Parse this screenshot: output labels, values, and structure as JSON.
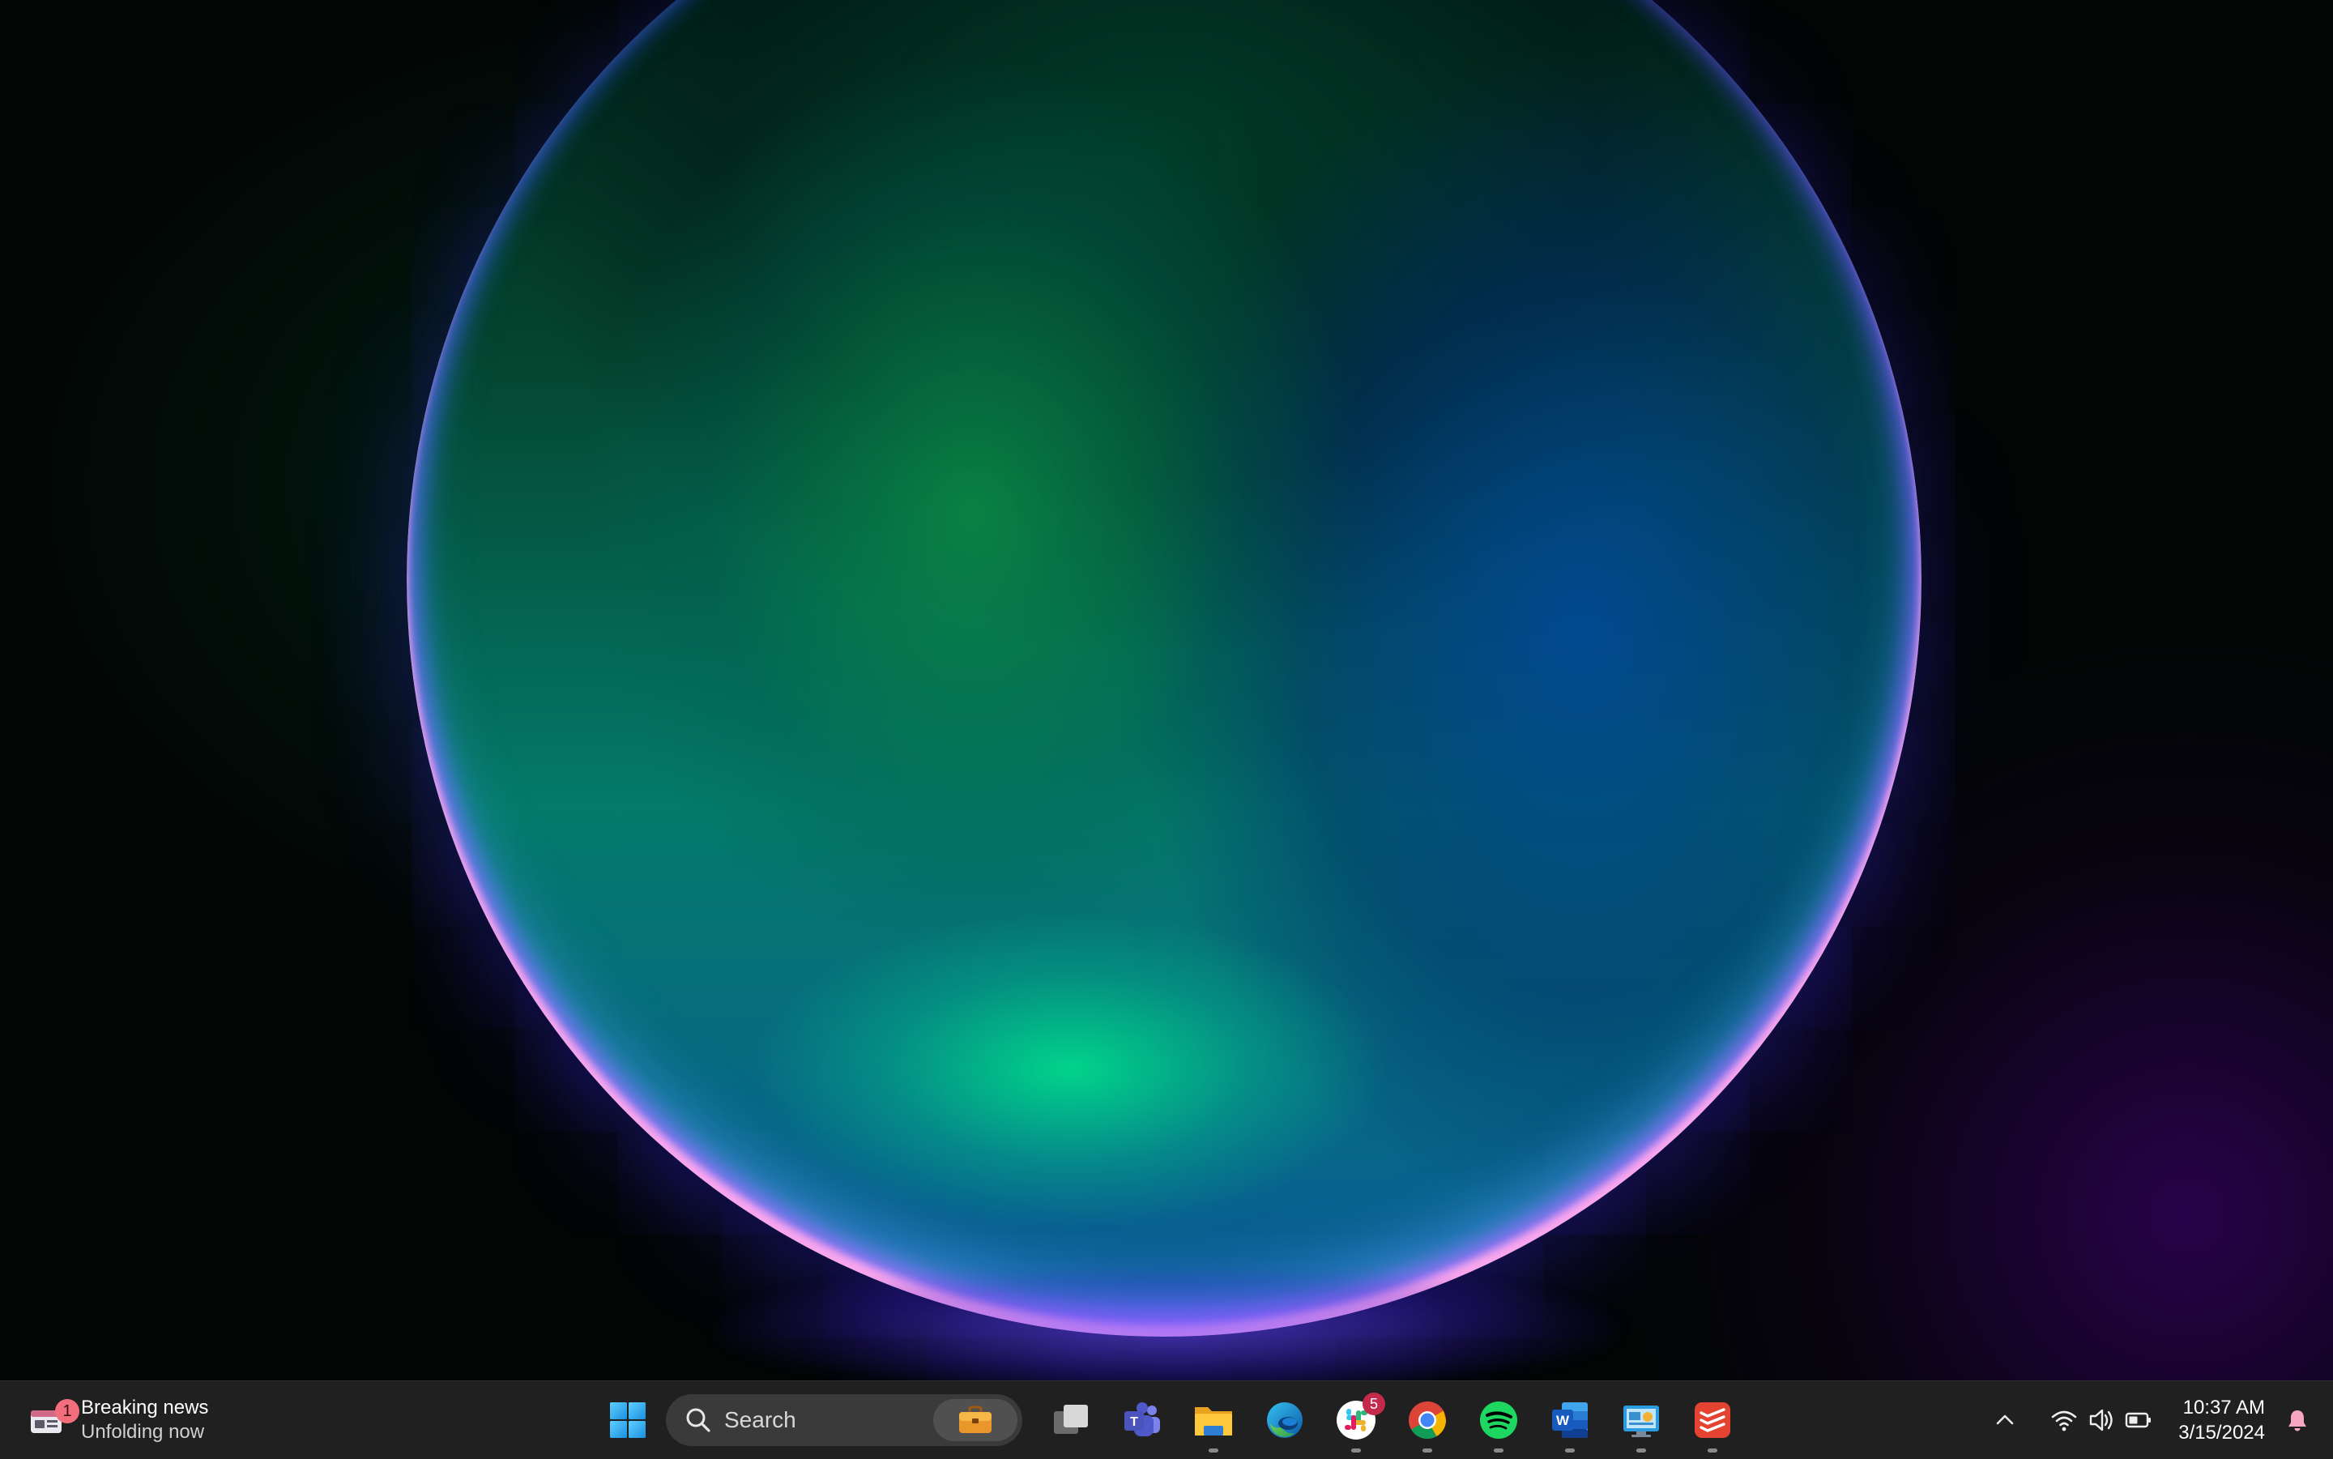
{
  "widgets": {
    "badge_count": "1",
    "title": "Breaking news",
    "subtitle": "Unfolding now"
  },
  "search": {
    "placeholder": "Search"
  },
  "taskbar_apps": [
    {
      "name": "task-view",
      "running": false
    },
    {
      "name": "microsoft-teams",
      "running": false
    },
    {
      "name": "file-explorer",
      "running": true
    },
    {
      "name": "microsoft-edge",
      "running": false
    },
    {
      "name": "slack",
      "running": true,
      "badge": "5"
    },
    {
      "name": "google-chrome",
      "running": true
    },
    {
      "name": "spotify",
      "running": true
    },
    {
      "name": "microsoft-word",
      "running": true
    },
    {
      "name": "control-panel",
      "running": true
    },
    {
      "name": "todoist",
      "running": true
    }
  ],
  "tray": {
    "time": "10:37 AM",
    "date": "3/15/2024"
  },
  "colors": {
    "taskbar_bg": "#202020",
    "notification_badge": "#c42b4b",
    "widget_badge": "#f26e7c",
    "accent_blue": "#3ab4f2"
  }
}
